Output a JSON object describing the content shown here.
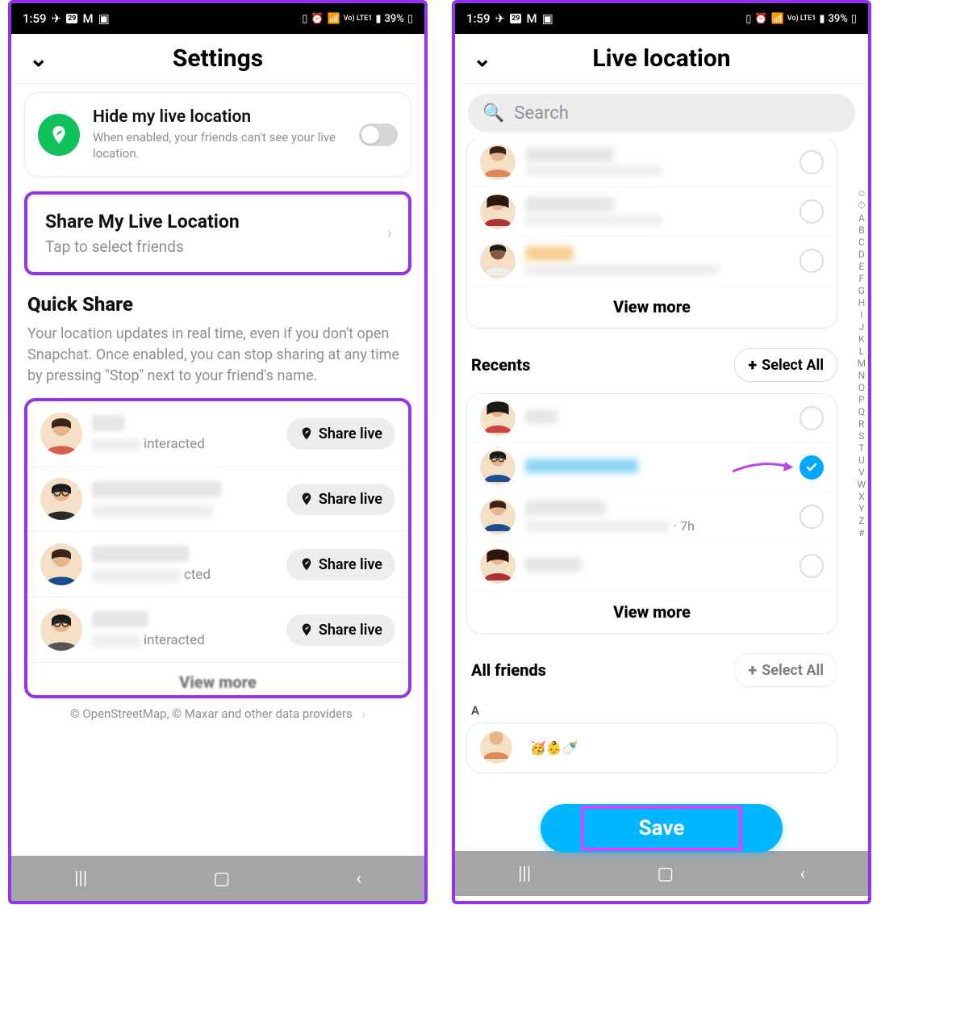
{
  "status": {
    "time": "1:59",
    "battery": "39%",
    "signal": "Vo) LTE1",
    "icons": [
      "telegram",
      "calendar-29",
      "gmail",
      "gallery",
      "card",
      "alarm",
      "wifi",
      "volte",
      "signal",
      "battery"
    ]
  },
  "left": {
    "title": "Settings",
    "hide": {
      "title": "Hide my live location",
      "sub": "When enabled, your friends can't see your live location.",
      "enabled": false
    },
    "share": {
      "title": "Share My Live Location",
      "sub": "Tap to select friends"
    },
    "quick": {
      "title": "Quick Share",
      "desc": "Your location updates in real time, even if you don't open Snapchat. Once enabled, you can stop sharing at any time by pressing \"Stop\" next to your friend's name.",
      "btn": "Share live",
      "interacted": "interacted",
      "cted": "cted",
      "view_more": "View more",
      "friends": [
        {
          "id": "f1"
        },
        {
          "id": "f2"
        },
        {
          "id": "f3"
        },
        {
          "id": "f4"
        }
      ]
    },
    "credit": "© OpenStreetMap, © Maxar and other data providers"
  },
  "right": {
    "title": "Live location",
    "search_placeholder": "Search",
    "view_more": "View more",
    "recents": "Recents",
    "select_all": "Select All",
    "all_friends": "All friends",
    "letter": "A",
    "save": "Save",
    "meta_7h": "· 7h",
    "contacts_top": [
      {
        "id": "t1"
      },
      {
        "id": "t2"
      },
      {
        "id": "t3"
      }
    ],
    "contacts_recents": [
      {
        "id": "r1",
        "checked": false
      },
      {
        "id": "r2",
        "checked": true,
        "highlight": true
      },
      {
        "id": "r3",
        "checked": false,
        "meta": "· 7h"
      },
      {
        "id": "r4",
        "checked": false
      }
    ],
    "az": [
      "☺",
      "⏱",
      "A",
      "B",
      "C",
      "D",
      "E",
      "F",
      "G",
      "H",
      "I",
      "J",
      "K",
      "L",
      "M",
      "N",
      "O",
      "P",
      "Q",
      "R",
      "S",
      "T",
      "U",
      "V",
      "W",
      "X",
      "Y",
      "Z",
      "#"
    ]
  }
}
